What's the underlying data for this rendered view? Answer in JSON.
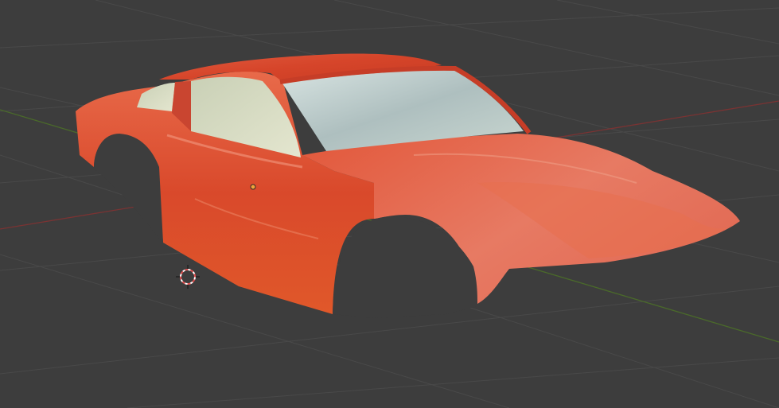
{
  "viewport": {
    "background_color": "#3d3d3d",
    "grid_color": "#4a4a4a",
    "x_axis_color": "#7a3333",
    "y_axis_color": "#4a6a2a"
  },
  "objects": {
    "car_body": {
      "icon": "car-body-mesh",
      "paint_color": "#d6452a",
      "glass_color": "#b9c9c7"
    },
    "origin_dot": {
      "icon": "object-origin-dot",
      "color": "#f2a33a"
    },
    "cursor_3d": {
      "icon": "3d-cursor-icon",
      "color": "#e05050"
    }
  }
}
